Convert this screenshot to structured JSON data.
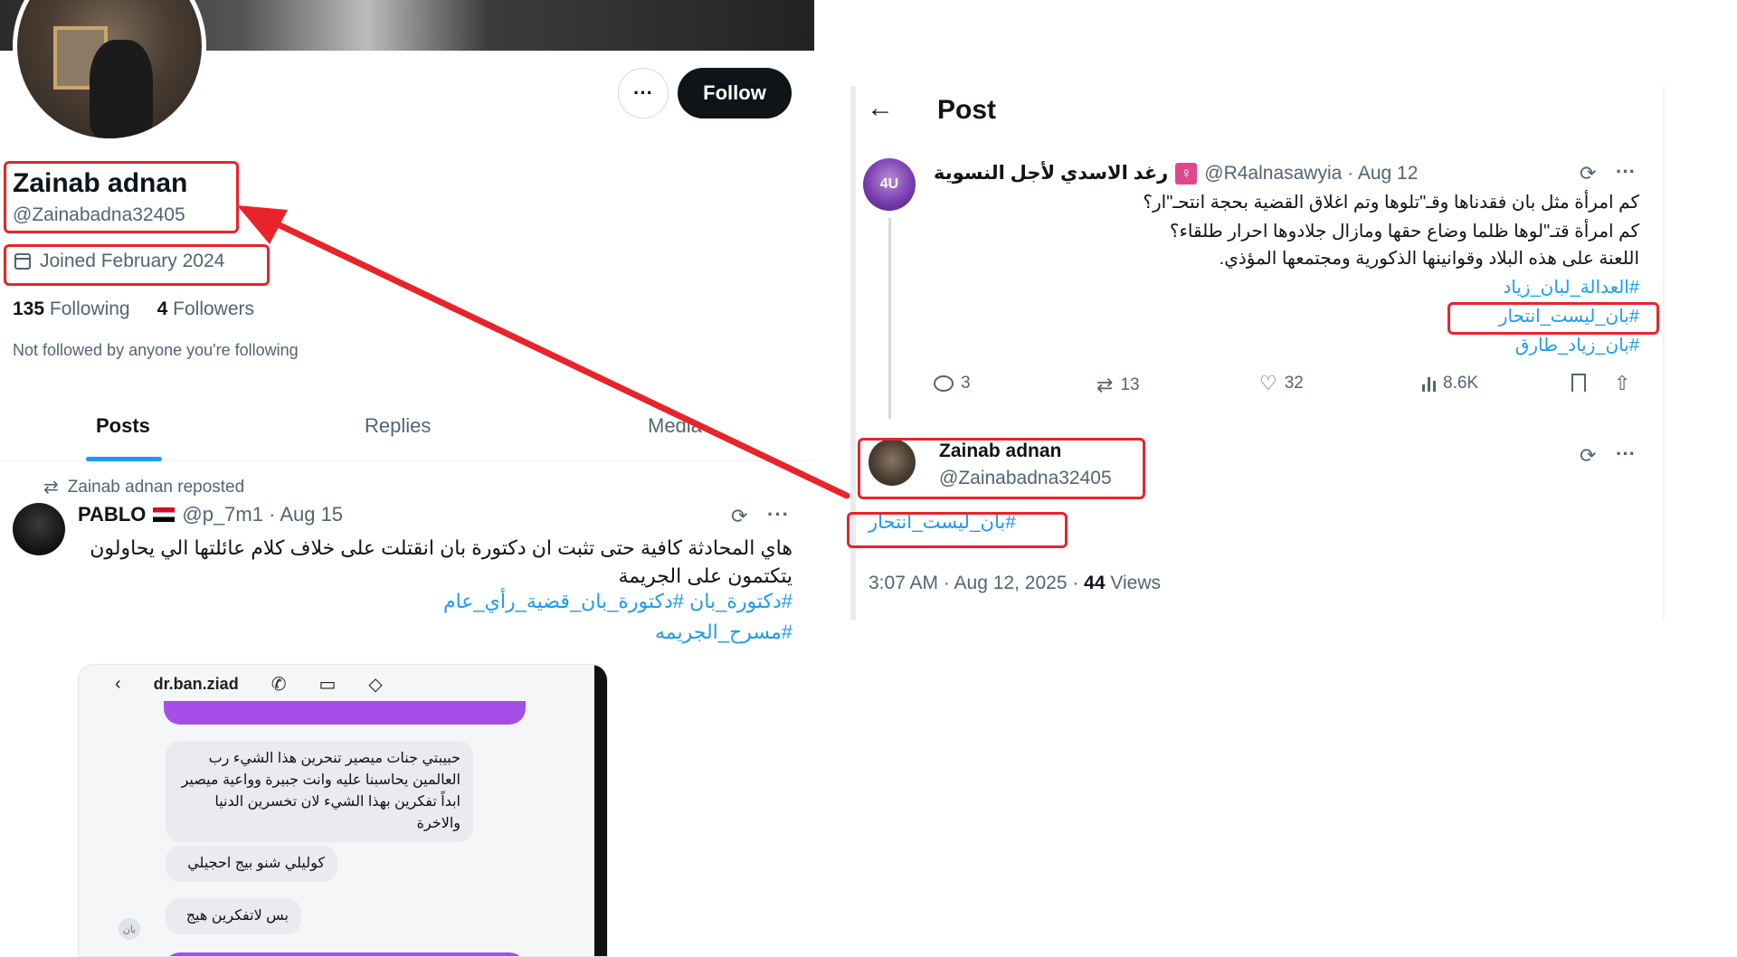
{
  "profile": {
    "display_name": "Zainab adnan",
    "handle": "@Zainabadna32405",
    "joined": "Joined February 2024",
    "following_count": "135",
    "following_label": "Following",
    "followers_count": "4",
    "followers_label": "Followers",
    "not_followed_text": "Not followed by anyone you're following",
    "more_label": "···",
    "follow_label": "Follow"
  },
  "tabs": [
    "Posts",
    "Replies",
    "Media"
  ],
  "repost": {
    "reposted_by": "Zainab adnan reposted",
    "author_name": "PABLO",
    "author_meta": "@p_7m1 · Aug 15",
    "text": "هاي المحادثة كافية حتى تثبت ان دكتورة بان انقتلت على خلاف كلام عائلتها الي يحاولون يتكتمون على الجريمة",
    "hashtags_line1": "#دكتورة_بان #دكتورة_بان_قضية_رأي_عام",
    "hashtags_line2": "#مسرح_الجريمه"
  },
  "chat_image": {
    "contact_name": "dr.ban.ziad",
    "bubble1": "حبيبتي جنات ميصير تنحرين هذا الشيء رب العالمين يحاسبنا عليه وانت جبيرة وواعية ميصير ابداً تفكرين بهذا الشيء لان تخسرين الدنيا والاخرة",
    "bubble2": "كوليلي شنو بيج احجيلي",
    "bubble3": "بس لاتفكرين هيج",
    "small_avatar": "بان"
  },
  "post_view": {
    "title": "Post",
    "author_name": "رغد الاسدي لأجل النسوية",
    "author_meta": "@R4alnasawyia · Aug 12",
    "avatar_text": "4U",
    "lines": [
      "كم امرأة مثل بان فقدناها وقـ\"تلوها وتم اغلاق القضية بحجة انتحـ\"ار؟",
      "كم امرأة قتـ\"لوها ظلما وضاع حقها ومازال جلادوها احرار طلقاء؟",
      "اللعنة على هذه البلاد وقوانينها الذكورية ومجتمعها المؤذي."
    ],
    "hashtags": [
      "#العدالة_لبان_زياد",
      "#بان_ليست_انتحار",
      "#بان_زياد_طارق"
    ],
    "stats": {
      "replies": "3",
      "reposts": "13",
      "likes": "32",
      "views": "8.6K"
    },
    "reply": {
      "author_name": "Zainab adnan",
      "author_handle": "@Zainabadna32405",
      "hashtag": "#بان_ليست_انتحار",
      "time": "3:07 AM · Aug 12, 2025 · ",
      "views_count": "44",
      "views_label": " Views"
    }
  },
  "colors": {
    "highlight_red": "#e8242a",
    "link_blue": "#1d9bf0",
    "text_dark": "#0f1419",
    "text_muted": "#536471"
  },
  "icons": [
    "more-icon",
    "calendar-icon",
    "repost-icon",
    "grok-icon",
    "back-arrow-icon",
    "reply-icon",
    "like-icon",
    "views-icon",
    "bookmark-icon",
    "share-icon"
  ]
}
